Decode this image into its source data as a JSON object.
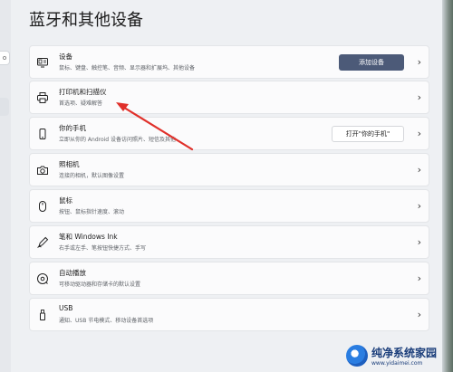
{
  "page": {
    "title": "蓝牙和其他设备"
  },
  "left_nav": {
    "search_glyph": "o"
  },
  "items": [
    {
      "title": "设备",
      "desc": "鼠标、键盘、触控笔、音频、显示器和扩展坞、其他设备",
      "icon": "devices-icon",
      "button": "添加设备",
      "button_style": "primary"
    },
    {
      "title": "打印机和扫描仪",
      "desc": "首选项、疑难解答",
      "icon": "printer-icon"
    },
    {
      "title": "你的手机",
      "desc": "立即从你的 Android 设备访问照片、短信及其他",
      "icon": "phone-icon",
      "button": "打开\"你的手机\"",
      "button_style": "secondary"
    },
    {
      "title": "照相机",
      "desc": "连接的相机，默认图像设置",
      "icon": "camera-icon"
    },
    {
      "title": "鼠标",
      "desc": "按钮、鼠标指针速度、滚动",
      "icon": "mouse-icon"
    },
    {
      "title": "笔和 Windows Ink",
      "desc": "右手或左手、笔按钮快捷方式、手写",
      "icon": "pen-icon"
    },
    {
      "title": "自动播放",
      "desc": "可移动驱动器和存储卡的默认设置",
      "icon": "autoplay-icon"
    },
    {
      "title": "USB",
      "desc": "通知、USB 节电模式、移动设备首选项",
      "icon": "usb-icon"
    }
  ],
  "chevron": "›",
  "watermark": {
    "name": "纯净系统家园",
    "url": "www.yidaimei.com"
  },
  "colors": {
    "primary_button": "#4c5a78",
    "arrow": "#e0302a"
  }
}
